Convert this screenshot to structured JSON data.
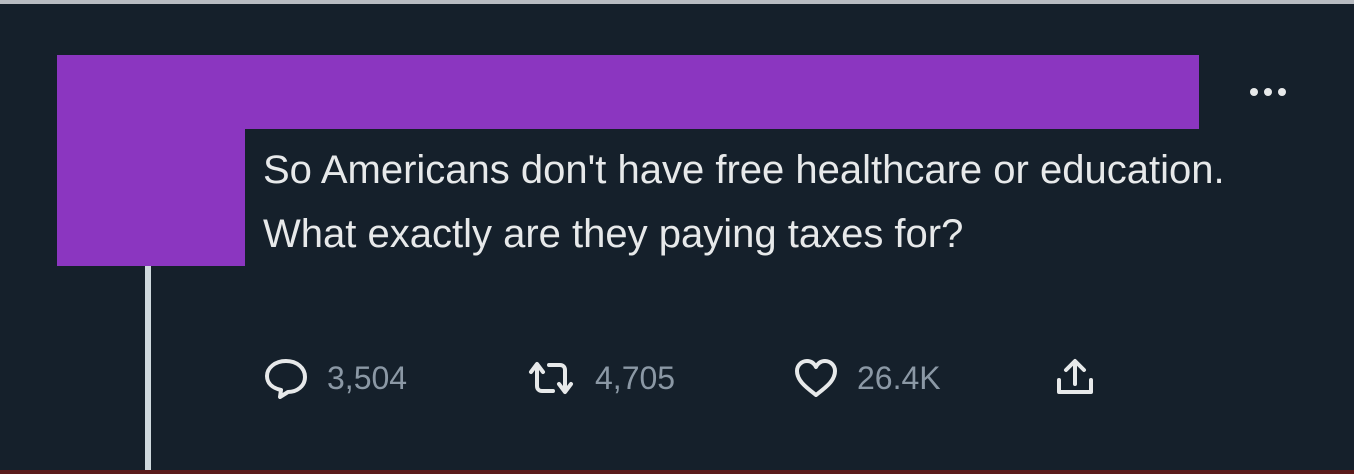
{
  "tweet": {
    "text": "So Americans don't have free healthcare or education. What exactly are they paying taxes for?",
    "more_icon": "more-horizontal-icon",
    "actions": {
      "reply": {
        "icon": "reply-icon",
        "count": "3,504"
      },
      "retweet": {
        "icon": "retweet-icon",
        "count": "4,705"
      },
      "like": {
        "icon": "heart-icon",
        "count": "26.4K"
      },
      "share": {
        "icon": "share-icon"
      }
    }
  },
  "colors": {
    "background": "#15202b",
    "redaction": "#8b36c0",
    "text": "#e7e9ea",
    "muted": "#8b98a5"
  }
}
